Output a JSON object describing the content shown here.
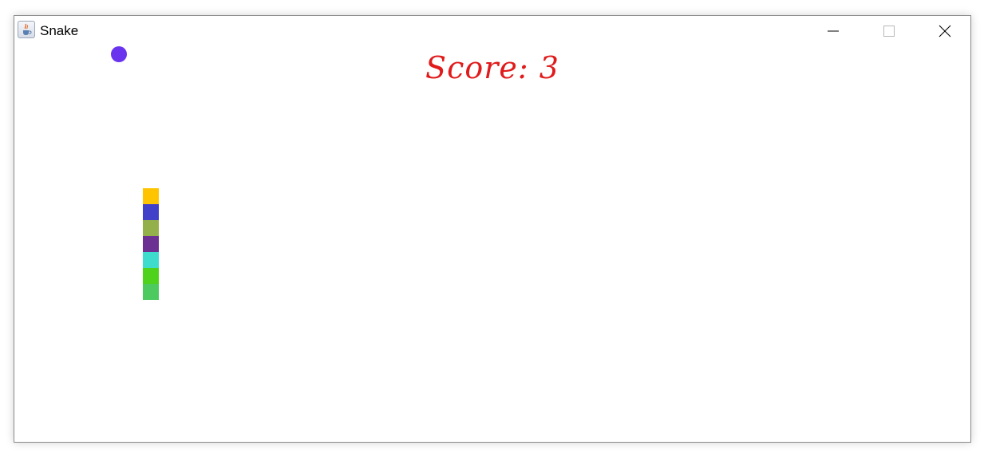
{
  "window": {
    "title": "Snake",
    "icon": "java-cup-icon",
    "controls": [
      "minimize-icon",
      "maximize-icon",
      "close-icon"
    ]
  },
  "game": {
    "score_text": "Score: 3",
    "score_color": "#e01b1b",
    "food_color": "#6a33ee",
    "snake_segments": [
      {
        "color": "#ffc400"
      },
      {
        "color": "#4040c8"
      },
      {
        "color": "#94b04a"
      },
      {
        "color": "#6b3092"
      },
      {
        "color": "#3ddccc"
      },
      {
        "color": "#4ed21c"
      },
      {
        "color": "#4cc95f"
      }
    ]
  }
}
